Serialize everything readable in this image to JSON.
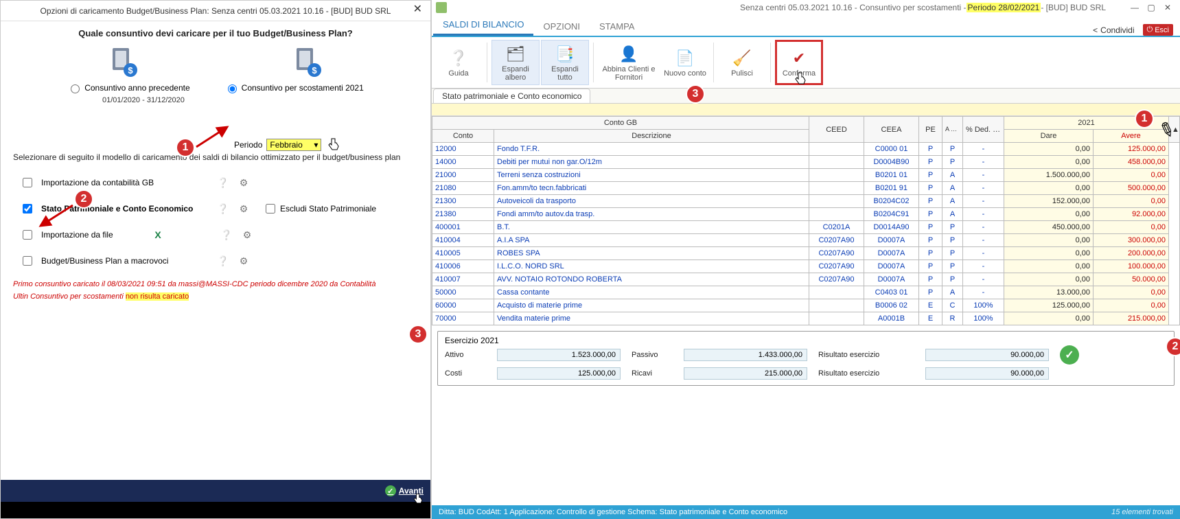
{
  "dialog": {
    "title": "Opzioni di caricamento Budget/Business Plan: Senza centri 05.03.2021 10.16 - [BUD] BUD SRL",
    "question": "Quale consuntivo devi caricare per il tuo Budget/Business Plan?",
    "radio": {
      "prev": "Consuntivo anno precedente",
      "scost": "Consuntivo per scostamenti 2021"
    },
    "date_range": "01/01/2020 - 31/12/2020",
    "periodo_label": "Periodo",
    "periodo_value": "Febbraio",
    "select_note": "Selezionare di seguito il modello di caricamento dei saldi di bilancio ottimizzato per il budget/business plan",
    "options": {
      "cont_gb": "Importazione da contabilità GB",
      "stato": "Stato Patrimoniale e Conto Economico",
      "escludi": "Escludi Stato Patrimoniale",
      "file": "Importazione da file",
      "macro": "Budget/Business Plan a macrovoci"
    },
    "notes": {
      "first": "Primo consuntivo caricato il 08/03/2021 09:51 da massi@MASSI-CDC periodo dicembre 2020 da Contabilità",
      "second_a": "Ultin",
      "second_b": "Consuntivo per scostamenti",
      "second_hl": "non risulta caricato"
    },
    "avanti": "Avanti"
  },
  "right": {
    "title_prefix": "Senza centri 05.03.2021 10.16 - Consuntivo per scostamenti - ",
    "title_hl": "Periodo 28/02/2021",
    "title_suffix": " - [BUD] BUD SRL",
    "tabs": [
      "SALDI DI BILANCIO",
      "OPZIONI",
      "STAMPA"
    ],
    "toolbar": {
      "guida": "Guida",
      "esp_alb": "Espandi albero",
      "esp_tutto": "Espandi tutto",
      "abbina": "Abbina Clienti e Fornitori",
      "nuovo": "Nuovo conto",
      "pulisci": "Pulisci",
      "conferma": "Conferma"
    },
    "share": "Condividi",
    "esci": "Esci",
    "subtab": "Stato patrimoniale e Conto economico",
    "headers": {
      "conto_gb": "Conto GB",
      "conto": "Conto",
      "descr": "Descrizione",
      "ceed": "CEED",
      "ceea": "CEEA",
      "pe": "PE",
      "apcr": "A P C R",
      "ded": "% Ded. IIDD",
      "year": "2021",
      "dare": "Dare",
      "avere": "Avere"
    },
    "rows": [
      {
        "conto": "12000",
        "descr": "Fondo T.F.R.",
        "ceed": "",
        "ceea": "C0000 01",
        "pe": "P",
        "apcr": "P",
        "ded": "-",
        "dare": "0,00",
        "avere": "125.000,00",
        "red": true
      },
      {
        "conto": "14000",
        "descr": "Debiti per mutui non gar.O/12m",
        "ceed": "",
        "ceea": "D0004B90",
        "pe": "P",
        "apcr": "P",
        "ded": "-",
        "dare": "0,00",
        "avere": "458.000,00",
        "red": true
      },
      {
        "conto": "21000",
        "descr": "Terreni senza costruzioni",
        "ceed": "",
        "ceea": "B0201 01",
        "pe": "P",
        "apcr": "A",
        "ded": "-",
        "dare": "1.500.000,00",
        "avere": "0,00",
        "red": false,
        "avred": true
      },
      {
        "conto": "21080",
        "descr": "Fon.amm/to tecn.fabbricati",
        "ceed": "",
        "ceea": "B0201 91",
        "pe": "P",
        "apcr": "A",
        "ded": "-",
        "dare": "0,00",
        "avere": "500.000,00",
        "red": true
      },
      {
        "conto": "21300",
        "descr": "Autoveicoli da trasporto",
        "ceed": "",
        "ceea": "B0204C02",
        "pe": "P",
        "apcr": "A",
        "ded": "-",
        "dare": "152.000,00",
        "avere": "0,00",
        "red": false,
        "avred": true
      },
      {
        "conto": "21380",
        "descr": "Fondi amm/to autov.da trasp.",
        "ceed": "",
        "ceea": "B0204C91",
        "pe": "P",
        "apcr": "A",
        "ded": "-",
        "dare": "0,00",
        "avere": "92.000,00",
        "red": true
      },
      {
        "conto": "400001",
        "descr": "B.T.",
        "ceed": "C0201A",
        "ceea": "D0014A90",
        "pe": "P",
        "apcr": "P",
        "ded": "-",
        "dare": "450.000,00",
        "avere": "0,00",
        "red": false,
        "avred": true
      },
      {
        "conto": "410004",
        "descr": "A.I.A SPA",
        "ceed": "C0207A90",
        "ceea": "D0007A",
        "pe": "P",
        "apcr": "P",
        "ded": "-",
        "dare": "0,00",
        "avere": "300.000,00",
        "red": true
      },
      {
        "conto": "410005",
        "descr": "ROBES SPA",
        "ceed": "C0207A90",
        "ceea": "D0007A",
        "pe": "P",
        "apcr": "P",
        "ded": "-",
        "dare": "0,00",
        "avere": "200.000,00",
        "red": true
      },
      {
        "conto": "410006",
        "descr": "I.L.C.O. NORD SRL",
        "ceed": "C0207A90",
        "ceea": "D0007A",
        "pe": "P",
        "apcr": "P",
        "ded": "-",
        "dare": "0,00",
        "avere": "100.000,00",
        "red": true
      },
      {
        "conto": "410007",
        "descr": "AVV. NOTAIO ROTONDO ROBERTA",
        "ceed": "C0207A90",
        "ceea": "D0007A",
        "pe": "P",
        "apcr": "P",
        "ded": "-",
        "dare": "0,00",
        "avere": "50.000,00",
        "red": true
      },
      {
        "conto": "50000",
        "descr": "Cassa contante",
        "ceed": "",
        "ceea": "C0403 01",
        "pe": "P",
        "apcr": "A",
        "ded": "-",
        "dare": "13.000,00",
        "avere": "0,00",
        "red": false,
        "avred": true
      },
      {
        "conto": "60000",
        "descr": "Acquisto di materie prime",
        "ceed": "",
        "ceea": "B0006 02",
        "pe": "E",
        "apcr": "C",
        "ded": "100%",
        "dare": "125.000,00",
        "avere": "0,00",
        "red": false,
        "avred": true
      },
      {
        "conto": "70000",
        "descr": "Vendita materie prime",
        "ceed": "",
        "ceea": "A0001B",
        "pe": "E",
        "apcr": "R",
        "ded": "100%",
        "dare": "0,00",
        "avere": "215.000,00",
        "red": true
      }
    ],
    "summary": {
      "legend": "Esercizio 2021",
      "attivo_l": "Attivo",
      "attivo_v": "1.523.000,00",
      "passivo_l": "Passivo",
      "passivo_v": "1.433.000,00",
      "ris_l": "Risultato esercizio",
      "ris_v": "90.000,00",
      "costi_l": "Costi",
      "costi_v": "125.000,00",
      "ricavi_l": "Ricavi",
      "ricavi_v": "215.000,00",
      "ris2_v": "90.000,00"
    },
    "status_left": "Ditta: BUD   CodAtt: 1   Applicazione: Controllo di gestione   Schema: Stato patrimoniale e Conto economico",
    "status_right": "15 elementi trovati"
  }
}
